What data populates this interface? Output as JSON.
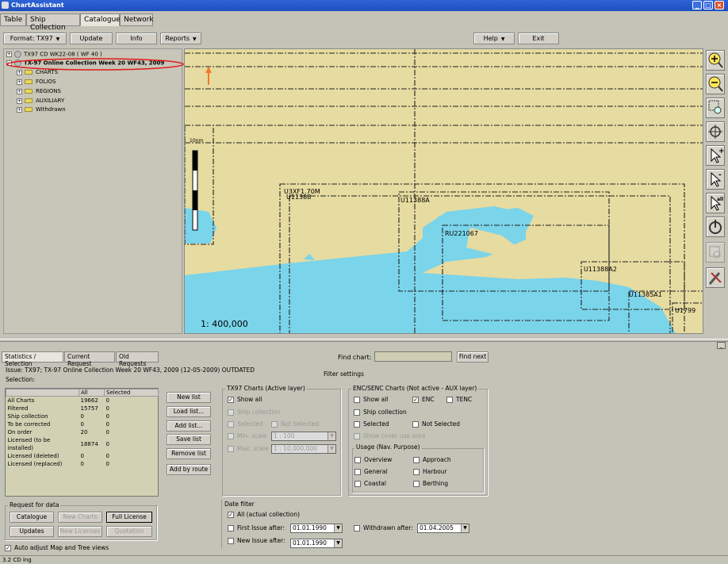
{
  "window": {
    "title": "ChartAssistant"
  },
  "tabs": [
    "Table",
    "Ship Collection",
    "Catalogue",
    "Network"
  ],
  "toolbar": {
    "format": "Format: TX97",
    "update": "Update",
    "info": "Info",
    "reports": "Reports",
    "help": "Help",
    "exit": "Exit"
  },
  "tree": {
    "root1": "TX97 CD WK22-08 ( WF 40 )",
    "root2": "TX-97 Online Collection Week 20 WF43, 2009",
    "children": [
      "CHARTS",
      "FOLIOS",
      "REGIONS",
      "AUXILIARY",
      "Withdrawn"
    ]
  },
  "map": {
    "scale_label": "10nm",
    "scale_text": "1: 400,000",
    "chart_labels": [
      "U3XF1.70M",
      "U11388",
      "U11388A",
      "RU221067",
      "U11388A2",
      "U11385A1",
      "U1799"
    ]
  },
  "bottom_tabs": [
    "Statistics / Selection",
    "Current Request",
    "Old Requests"
  ],
  "find": {
    "label": "Find chart:",
    "value": "",
    "button": "Find next"
  },
  "issue_line": "Issue:  TX97; TX-97 Online Collection Week 20 WF43, 2009  (12-05-2009) OUTDATED",
  "selection_label": "Selection:",
  "filter_settings": "Filter settings",
  "stats": {
    "headers": [
      "",
      "All",
      "Selected"
    ],
    "rows": [
      [
        "All Charts",
        "19662",
        "0"
      ],
      [
        "Filtered",
        "15757",
        "0"
      ],
      [
        "Ship collection",
        "0",
        "0"
      ],
      [
        "To be corrected",
        "0",
        "0"
      ],
      [
        "On order",
        "20",
        "0"
      ],
      [
        "Licensed (to be installed)",
        "18874",
        "0"
      ],
      [
        "Licensed (deleted)",
        "0",
        "0"
      ],
      [
        "Licensed (replaced)",
        "0",
        "0"
      ]
    ]
  },
  "list_buttons": [
    "New list",
    "Load list...",
    "Add list...",
    "Save list",
    "Remove list",
    "Add by route"
  ],
  "tx97": {
    "title": "TX97 Charts (Active layer)",
    "show_all": "Show all",
    "ship_collection": "Ship collection",
    "selected": "Selected",
    "not_selected": "Not Selected",
    "min_scale": "Min. scale",
    "min_scale_value": "1 : 100",
    "max_scale": "Max. scale",
    "max_scale_value": "1 : 10,000,000"
  },
  "enc": {
    "title": "ENC/SENC Charts (Not active - AUX layer)",
    "show_all": "Show all",
    "enc": "ENC",
    "tenc": "TENC",
    "ship_collection": "Ship collection",
    "selected": "Selected",
    "not_selected": "Not Selected",
    "show_cover": "Show cover use area",
    "usage_title": "Usage (Nav. Purpose)",
    "overview": "Overview",
    "approach": "Approach",
    "general": "General",
    "harbour": "Harbour",
    "coastal": "Coastal",
    "berthing": "Berthing"
  },
  "request": {
    "title": "Request for data",
    "catalogue": "Catalogue",
    "new_charts": "New Charts",
    "full_license": "Full License",
    "updates": "Updates",
    "new_licenses": "New Licenses",
    "quotation": "Quotation"
  },
  "auto_adjust": "Auto adjust Map and Tree views",
  "date_filter": {
    "title": "Date filter",
    "all": "All (actual collection)",
    "first_issue": "First Issue after:",
    "first_issue_date": "01.01.1990",
    "new_issue": "New Issue after:",
    "new_issue_date": "01.01.1990",
    "withdrawn": "Withdrawn after:",
    "withdrawn_date": "01.04.2005"
  },
  "status": "3.2 CD ing"
}
